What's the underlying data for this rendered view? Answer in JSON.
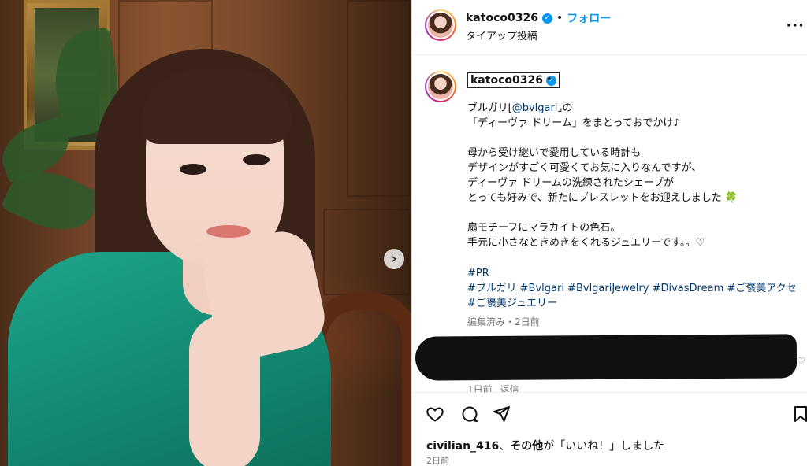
{
  "post": {
    "username": "katoco0326",
    "follow_label": "フォロー",
    "separator": "•",
    "subtitle": "タイアップ投稿",
    "more_icon": "more-horizontal-icon",
    "caption": {
      "line1_a": "ブルガリ⌊",
      "line1_mention": "@bvlgari",
      "line1_b": "⌟の",
      "rest": "「ディーヴァ ドリーム」をまとっておでかけ♪\n\n母から受け継いで愛用している時計も\nデザインがすごく可愛くてお気に入りなんですが、\nディーヴァ ドリームの洗練されたシェープが\nとっても好みで、新たにブレスレットをお迎えしました 🍀\n\n扇モチーフにマラカイトの色石。\n手元に小さなときめきをくれるジュエリーです。。♡"
    },
    "hashtags": "#PR\n#ブルガリ #Bvlgari #BvlgariJewelry #DivasDream #ご褒美アクセ #ご褒美ジュエリー",
    "edited_meta": "編集済み・2日前",
    "comment_meta": {
      "time": "1日前",
      "reply": "返信"
    },
    "likes": {
      "user": "civilian_416",
      "sep": "、",
      "others": "その他",
      "suffix": "が「いいね！」しました"
    },
    "time_ago": "2日前"
  },
  "colors": {
    "accent": "#0095f6",
    "link": "#00376b",
    "muted": "#737373"
  }
}
